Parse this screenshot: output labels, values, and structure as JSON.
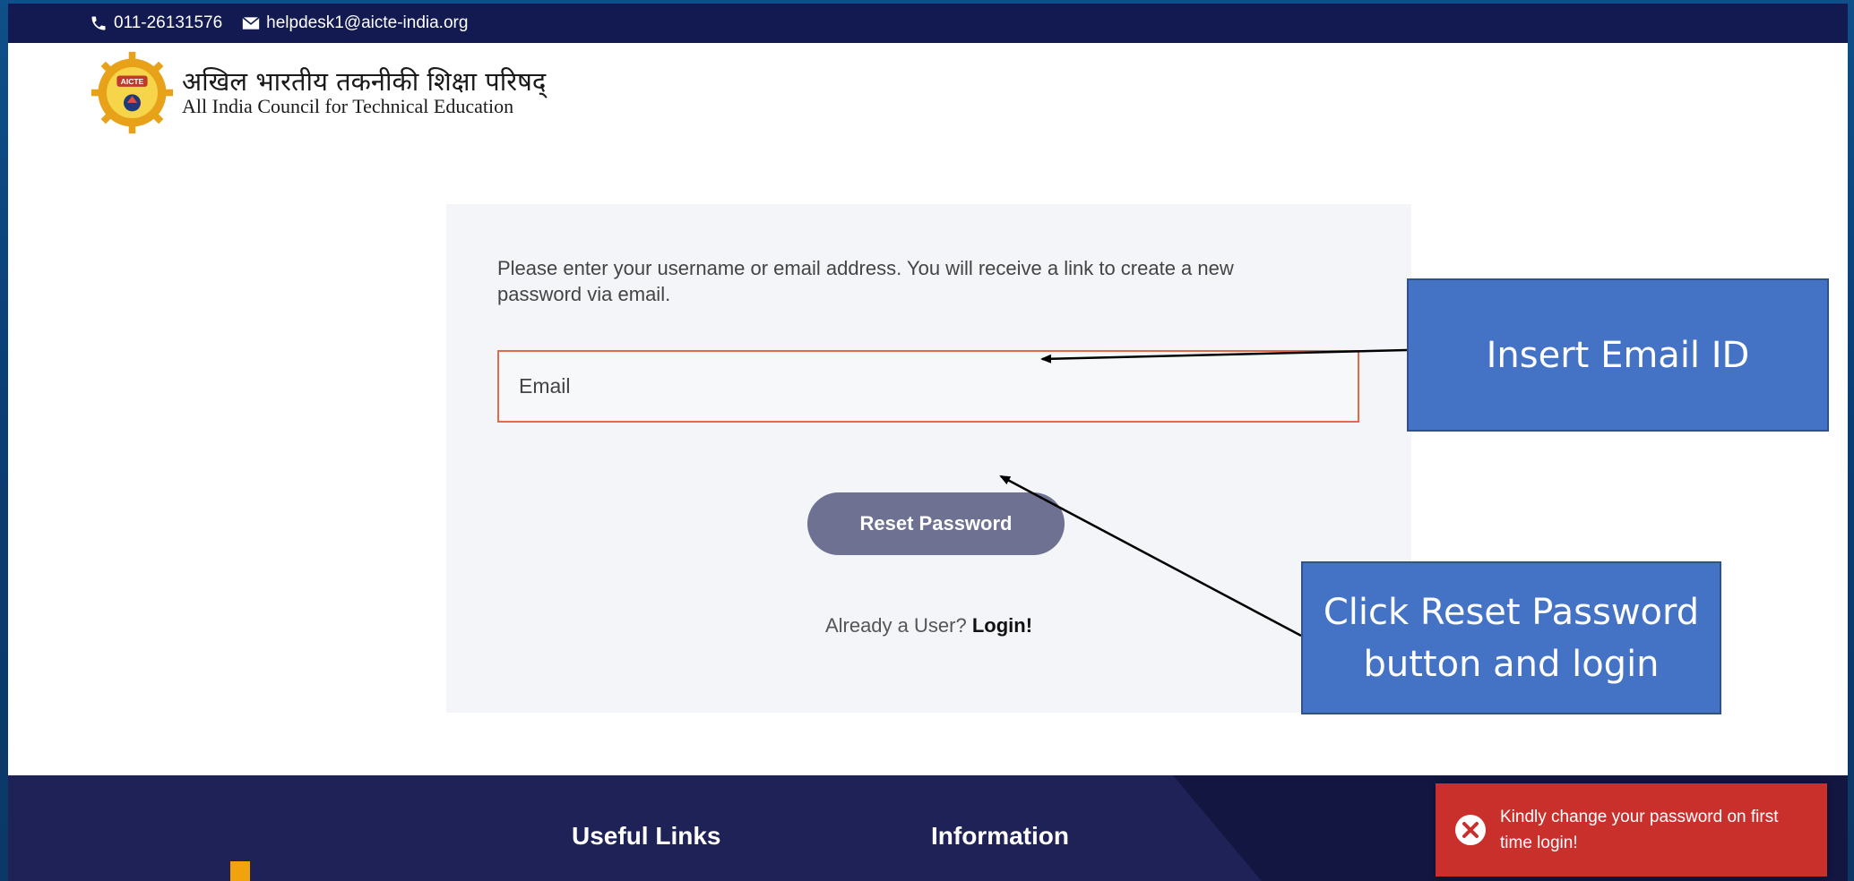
{
  "topbar": {
    "phone": "011-26131576",
    "email": "helpdesk1@aicte-india.org",
    "phone_icon": "phone-icon",
    "email_icon": "envelope-icon"
  },
  "logo": {
    "hindi": "अखिल भारतीय तकनीकी शिक्षा परिषद्",
    "english": "All India Council for Technical Education",
    "emblem_text": "AICTE"
  },
  "reset_form": {
    "message": "Please enter your username or email address. You will receive a link to create a new password via email.",
    "email_placeholder": "Email",
    "email_value": "",
    "button_label": "Reset Password",
    "already_text": "Already a User?",
    "login_link": "Login!"
  },
  "footer": {
    "useful_links": "Useful Links",
    "information": "Information"
  },
  "toast": {
    "message": "Kindly change your password on first time login!",
    "icon": "close-circle-icon",
    "color": "#c9302c"
  },
  "annotations": {
    "insert_email": "Insert Email ID",
    "click_reset": "Click Reset Password button and login",
    "color": "#4472c4"
  }
}
